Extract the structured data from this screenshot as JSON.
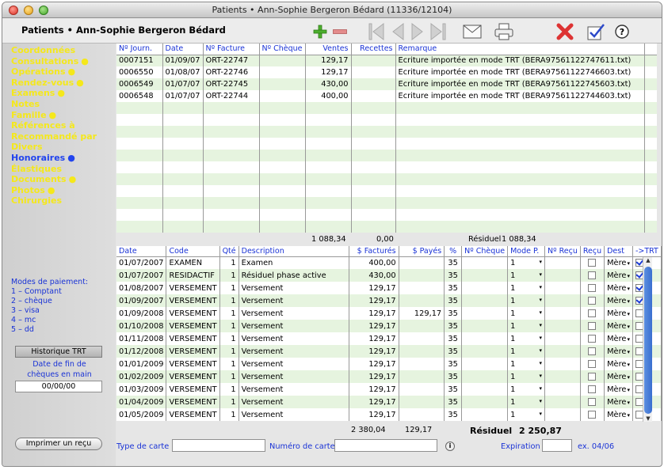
{
  "window": {
    "title": "Patients • Ann-Sophie Bergeron Bédard (11336/12104)"
  },
  "header": {
    "patient_title": "Patients • Ann-Sophie Bergeron Bédard"
  },
  "sidebar": {
    "items": [
      {
        "label": "Coordonnées",
        "dot": ""
      },
      {
        "label": "Consultations",
        "dot": "●"
      },
      {
        "label": "Opérations",
        "dot": "●"
      },
      {
        "label": "Rendez-vous",
        "dot": "●"
      },
      {
        "label": "Examens",
        "dot": "●"
      },
      {
        "label": "Notes",
        "dot": ""
      },
      {
        "label": "Famille",
        "dot": "●"
      },
      {
        "label": "Références à",
        "dot": ""
      },
      {
        "label": "Recommandé par",
        "dot": ""
      },
      {
        "label": "Divers",
        "dot": ""
      },
      {
        "label": "Honoraires",
        "dot": "●"
      },
      {
        "label": "Élastiques",
        "dot": ""
      },
      {
        "label": "Documents",
        "dot": "●"
      },
      {
        "label": "Photos",
        "dot": "●"
      },
      {
        "label": "Chirurgies",
        "dot": ""
      }
    ],
    "payment_modes": [
      "Modes de paiement:",
      "1 – Comptant",
      "2 – chèque",
      "3 – visa",
      "4 – mc",
      "5 – dd"
    ],
    "history_button": "Historique TRT",
    "end_date_label_1": "Date de fin de",
    "end_date_label_2": "chèques en main",
    "end_date_value": "00/00/00",
    "print_button": "Imprimer un reçu"
  },
  "journal": {
    "columns": [
      "Nº Journ.",
      "Date",
      "Nº Facture",
      "Nº Chèque",
      "Ventes",
      "Recettes",
      "Remarque"
    ],
    "rows": [
      [
        "0007151",
        "01/09/07",
        "ORT-22747",
        "",
        "129,17",
        "",
        "Ecriture importée en mode TRT (BERA97561122747611.txt)"
      ],
      [
        "0006550",
        "01/08/07",
        "ORT-22746",
        "",
        "129,17",
        "",
        "Ecriture importée en mode TRT (BERA97561122746603.txt)"
      ],
      [
        "0006549",
        "01/07/07",
        "ORT-22745",
        "",
        "430,00",
        "",
        "Ecriture importée en mode TRT (BERA97561122745603.txt)"
      ],
      [
        "0006548",
        "01/07/07",
        "ORT-22744",
        "",
        "400,00",
        "",
        "Ecriture importée en mode TRT (BERA97561122744603.txt)"
      ]
    ],
    "total_ventes": "1 088,34",
    "total_recettes": "0,00",
    "residuel_label": "Résiduel",
    "residuel_value": "1 088,34"
  },
  "fees": {
    "columns": [
      "Date",
      "Code",
      "Qté",
      "Description",
      "$ Facturés",
      "$ Payés",
      "%",
      "Nº Chèque",
      "Mode P.",
      "Nº Reçu",
      "Reçu",
      "Dest",
      "->TRT"
    ],
    "rows": [
      {
        "date": "01/07/2007",
        "code": "EXAMEN",
        "qty": "1",
        "desc": "Examen",
        "billed": "400,00",
        "paid": "",
        "pct": "35",
        "cheque": "",
        "mode": "1",
        "receipt_no": "",
        "received": false,
        "dest": "Mère",
        "trt": true
      },
      {
        "date": "01/07/2007",
        "code": "RESIDACTIF",
        "qty": "1",
        "desc": "Résiduel phase active",
        "billed": "430,00",
        "paid": "",
        "pct": "35",
        "cheque": "",
        "mode": "1",
        "receipt_no": "",
        "received": false,
        "dest": "Mère",
        "trt": true
      },
      {
        "date": "01/08/2007",
        "code": "VERSEMENT",
        "qty": "1",
        "desc": "Versement",
        "billed": "129,17",
        "paid": "",
        "pct": "35",
        "cheque": "",
        "mode": "1",
        "receipt_no": "",
        "received": false,
        "dest": "Mère",
        "trt": true
      },
      {
        "date": "01/09/2007",
        "code": "VERSEMENT",
        "qty": "1",
        "desc": "Versement",
        "billed": "129,17",
        "paid": "",
        "pct": "35",
        "cheque": "",
        "mode": "1",
        "receipt_no": "",
        "received": false,
        "dest": "Mère",
        "trt": true
      },
      {
        "date": "01/09/2008",
        "code": "VERSEMENT",
        "qty": "1",
        "desc": "Versement",
        "billed": "129,17",
        "paid": "129,17",
        "pct": "35",
        "cheque": "",
        "mode": "1",
        "receipt_no": "",
        "received": false,
        "dest": "Mère",
        "trt": false
      },
      {
        "date": "01/10/2008",
        "code": "VERSEMENT",
        "qty": "1",
        "desc": "Versement",
        "billed": "129,17",
        "paid": "",
        "pct": "35",
        "cheque": "",
        "mode": "1",
        "receipt_no": "",
        "received": false,
        "dest": "Mère",
        "trt": false
      },
      {
        "date": "01/11/2008",
        "code": "VERSEMENT",
        "qty": "1",
        "desc": "Versement",
        "billed": "129,17",
        "paid": "",
        "pct": "35",
        "cheque": "",
        "mode": "1",
        "receipt_no": "",
        "received": false,
        "dest": "Mère",
        "trt": false
      },
      {
        "date": "01/12/2008",
        "code": "VERSEMENT",
        "qty": "1",
        "desc": "Versement",
        "billed": "129,17",
        "paid": "",
        "pct": "35",
        "cheque": "",
        "mode": "1",
        "receipt_no": "",
        "received": false,
        "dest": "Mère",
        "trt": false
      },
      {
        "date": "01/01/2009",
        "code": "VERSEMENT",
        "qty": "1",
        "desc": "Versement",
        "billed": "129,17",
        "paid": "",
        "pct": "35",
        "cheque": "",
        "mode": "1",
        "receipt_no": "",
        "received": false,
        "dest": "Mère",
        "trt": false
      },
      {
        "date": "01/02/2009",
        "code": "VERSEMENT",
        "qty": "1",
        "desc": "Versement",
        "billed": "129,17",
        "paid": "",
        "pct": "35",
        "cheque": "",
        "mode": "1",
        "receipt_no": "",
        "received": false,
        "dest": "Mère",
        "trt": false
      },
      {
        "date": "01/03/2009",
        "code": "VERSEMENT",
        "qty": "1",
        "desc": "Versement",
        "billed": "129,17",
        "paid": "",
        "pct": "35",
        "cheque": "",
        "mode": "1",
        "receipt_no": "",
        "received": false,
        "dest": "Mère",
        "trt": false
      },
      {
        "date": "01/04/2009",
        "code": "VERSEMENT",
        "qty": "1",
        "desc": "Versement",
        "billed": "129,17",
        "paid": "",
        "pct": "35",
        "cheque": "",
        "mode": "1",
        "receipt_no": "",
        "received": false,
        "dest": "Mère",
        "trt": false
      },
      {
        "date": "01/05/2009",
        "code": "VERSEMENT",
        "qty": "1",
        "desc": "Versement",
        "billed": "129,17",
        "paid": "",
        "pct": "35",
        "cheque": "",
        "mode": "1",
        "receipt_no": "",
        "received": false,
        "dest": "Mère",
        "trt": false
      }
    ],
    "total_billed": "2 380,04",
    "total_paid": "129,17",
    "residuel_label": "Résiduel",
    "residuel_value": "2 250,87"
  },
  "card": {
    "type_label": "Type de carte",
    "type_value": "",
    "number_label": "Numéro de carte",
    "number_value": "",
    "info_icon": "i",
    "expiration_label": "Expiration",
    "expiration_value": "",
    "example": "ex. 04/06"
  },
  "icons": [
    "add-icon",
    "remove-icon",
    "first-record-icon",
    "previous-record-icon",
    "next-record-icon",
    "last-record-icon",
    "mail-icon",
    "print-icon",
    "delete-icon",
    "edit-icon",
    "help-icon"
  ],
  "colors": {
    "nav_text": "#f5e81b",
    "nav_active": "#2244ee",
    "row_stripe": "#e6f4df",
    "header_text": "#1a33d6"
  }
}
